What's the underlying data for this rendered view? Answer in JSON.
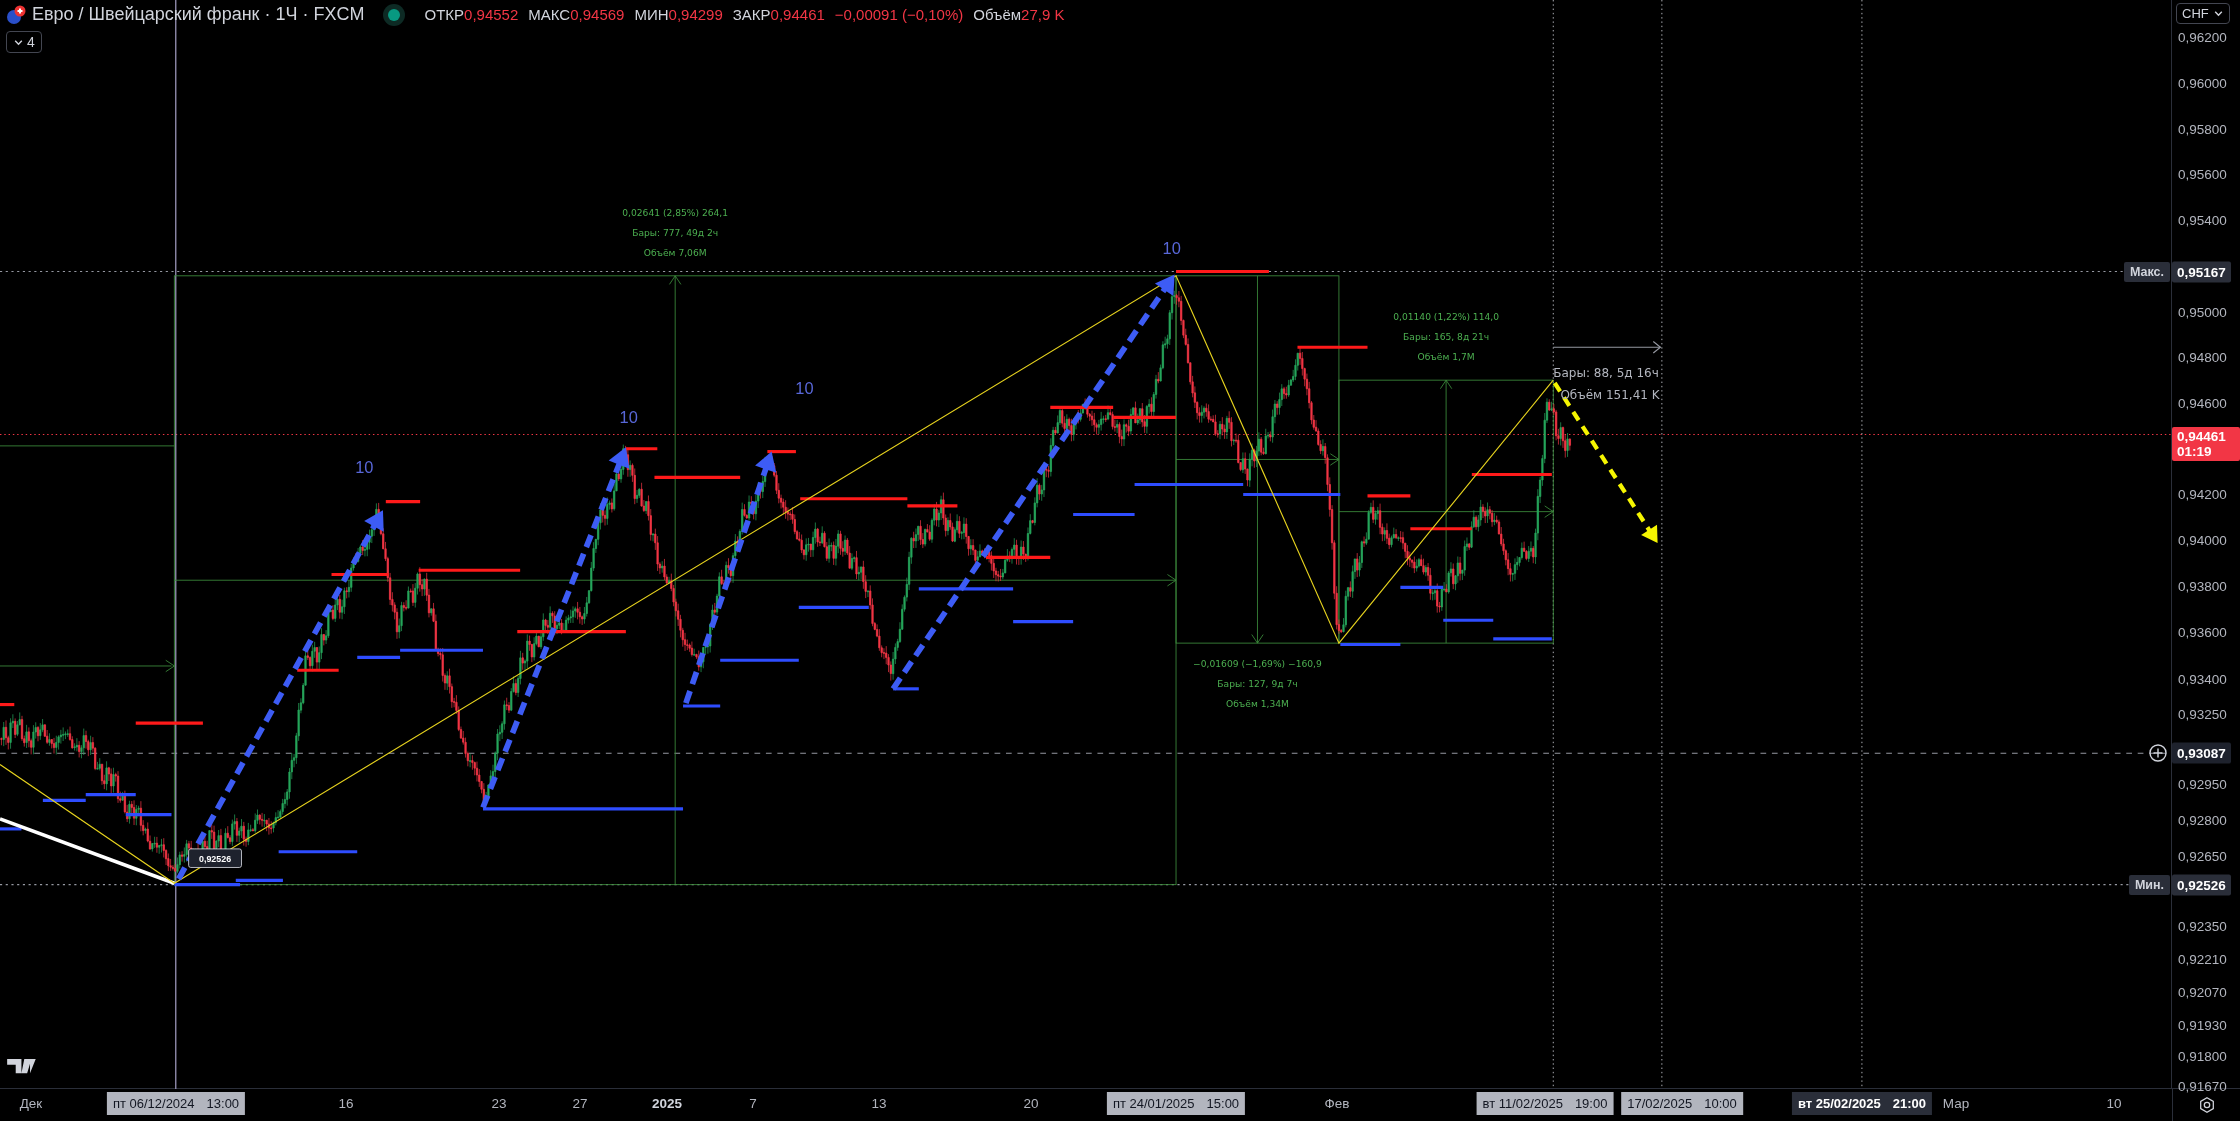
{
  "header": {
    "symbol": "Евро / Швейцарский франк · 1Ч · FXCM",
    "market_open": true,
    "ohlc": [
      {
        "label": "ОТКР",
        "value": "0,94552"
      },
      {
        "label": "МАКС",
        "value": "0,94569"
      },
      {
        "label": "МИН",
        "value": "0,94299"
      },
      {
        "label": "ЗАКР",
        "value": "0,94461"
      }
    ],
    "change": "−0,00091 (−0,10%)",
    "volume": {
      "label": "Объём",
      "value": "27,9 K"
    },
    "indicators_count": "4"
  },
  "currency_button": "CHF",
  "price_axis": {
    "ticks": [
      "0,96200",
      "0,96000",
      "0,95800",
      "0,95600",
      "0,95400",
      "0,95000",
      "0,94800",
      "0,94600",
      "0,94200",
      "0,94000",
      "0,93800",
      "0,93600",
      "0,93400",
      "0,93250",
      "0,92950",
      "0,92800",
      "0,92650",
      "0,92350",
      "0,92210",
      "0,92070",
      "0,91930",
      "0,91800",
      "0,91670"
    ],
    "markers": [
      {
        "kind": "max",
        "label": "Макс.",
        "value": "0,95167"
      },
      {
        "kind": "last",
        "value": "0,94461",
        "countdown": "01:19"
      },
      {
        "kind": "crosshair",
        "value": "0,93087"
      },
      {
        "kind": "min",
        "label": "Мин.",
        "value": "0,92526"
      }
    ]
  },
  "time_axis": [
    {
      "kind": "tick",
      "text": "Дек"
    },
    {
      "kind": "highlight",
      "text": "пт 06/12/2024",
      "time": "13:00"
    },
    {
      "kind": "tick",
      "text": "16"
    },
    {
      "kind": "tick",
      "text": "23"
    },
    {
      "kind": "tick",
      "text": "27"
    },
    {
      "kind": "year",
      "text": "2025"
    },
    {
      "kind": "tick",
      "text": "7"
    },
    {
      "kind": "tick",
      "text": "13"
    },
    {
      "kind": "tick",
      "text": "20"
    },
    {
      "kind": "highlight",
      "text": "пт 24/01/2025",
      "time": "15:00"
    },
    {
      "kind": "tick",
      "text": "Фев"
    },
    {
      "kind": "highlight",
      "text": "вт 11/02/2025",
      "time": "19:00"
    },
    {
      "kind": "highlight",
      "text": "17/02/2025",
      "time": "10:00"
    },
    {
      "kind": "dark",
      "text": "вт 25/02/2025",
      "time": "21:00"
    },
    {
      "kind": "tick",
      "text": "Мар"
    },
    {
      "kind": "tick",
      "text": "10"
    }
  ],
  "drawings": {
    "wave_counts": [
      "10",
      "10",
      "10",
      "10"
    ],
    "measurements": [
      {
        "kind": "up",
        "change": "0,02641 (2,85%) 264,1",
        "bars": "Бары: 777, 49д 2ч",
        "volume": "Объём 7,06M"
      },
      {
        "kind": "down",
        "change": "−0,01609 (−1,69%) −160,9",
        "bars": "Бары: 127, 9д 7ч",
        "volume": "Объём 1,34M"
      },
      {
        "kind": "up",
        "change": "0,01140 (1,22%) 114,0",
        "bars": "Бары: 165, 8д 21ч",
        "volume": "Объём 1,7M"
      }
    ],
    "date_range": {
      "bars": "Бары: 88, 5д 16ч",
      "volume": "Объём 151,41 K"
    },
    "point_label": "0,92526"
  }
}
